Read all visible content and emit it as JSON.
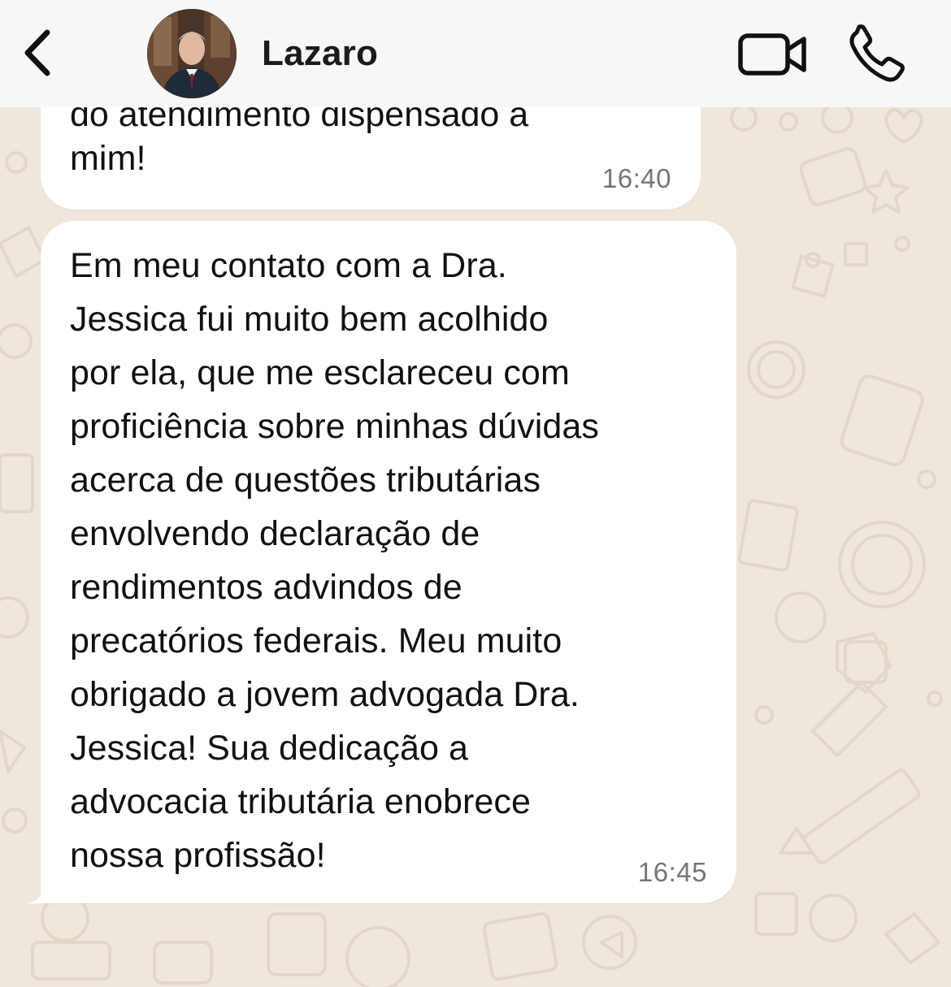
{
  "header": {
    "contact_name": "Lazaro",
    "back_icon": "chevron-left-icon",
    "video_icon": "video-camera-icon",
    "call_icon": "phone-icon"
  },
  "messages": [
    {
      "partial_top_text": "do atendimento dispensado a",
      "text": "mim!",
      "time": "16:40"
    },
    {
      "text": "Em meu contato com a Dra.\nJessica fui muito bem acolhido\npor ela, que me esclareceu com\nproficiência sobre minhas dúvidas\nacerca de questões tributárias\nenvolvendo declaração de\nrendimentos advindos de\nprecatórios federais. Meu muito\nobrigado a jovem advogada Dra.\nJessica! Sua dedicação a\nadvocacia tributária enobrece\nnossa profissão!",
      "time": "16:45"
    }
  ],
  "colors": {
    "wallpaper": "#efe7dd",
    "bubble": "#ffffff",
    "header": "#f7f7f7",
    "text": "#111111",
    "timestamp": "#767676",
    "doodle": "#e2d6c8"
  }
}
